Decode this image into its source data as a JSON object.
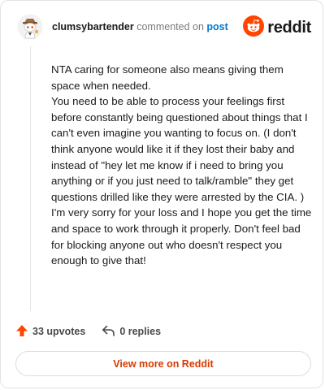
{
  "comment": {
    "username": "clumsybartender",
    "action_text": "commented on",
    "post_link": "post",
    "avatar_icon": "snoo-avatar-icon",
    "paragraphs": [
      "NTA caring for someone also means giving them space when needed.",
      "You need to be able to process your feelings first before constantly being questioned about things that I can't even imagine you wanting to focus on. (I don't think anyone would like it if they lost their baby and instead of \"hey let me know if i need to bring you anything or if you just need to talk/ramble\" they get questions drilled like they were arrested by the CIA. )",
      "I'm very sorry for your loss and I hope you get the time and space to work through it properly. Don't feel bad for blocking anyone out who doesn't respect you enough to give that!"
    ]
  },
  "brand": {
    "name": "reddit",
    "logo_icon": "reddit-logo-icon",
    "color": "#ff4500"
  },
  "actions": {
    "upvotes": "33 upvotes",
    "upvote_icon": "upvote-arrow-icon",
    "upvote_color": "#ff4500",
    "replies": "0 replies",
    "reply_icon": "reply-arrow-icon"
  },
  "footer": {
    "view_more_label": "View more on Reddit",
    "accent_color": "#d93a00"
  }
}
